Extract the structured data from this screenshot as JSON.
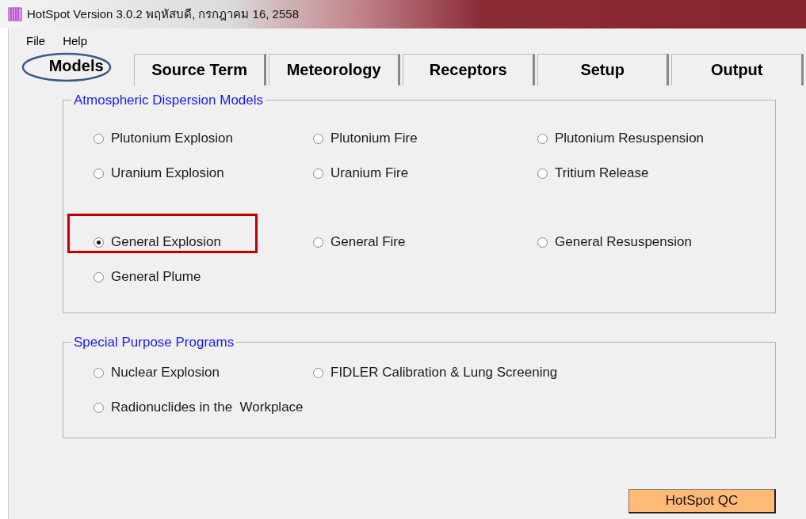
{
  "window": {
    "title": "HotSpot Version 3.0.2 พฤหัสบดี, กรกฎาคม 16, 2558"
  },
  "menu": [
    "File",
    "Help"
  ],
  "tabs": [
    {
      "label": "Models",
      "selected": true
    },
    {
      "label": "Source Term",
      "selected": false
    },
    {
      "label": "Meteorology",
      "selected": false
    },
    {
      "label": "Receptors",
      "selected": false
    },
    {
      "label": "Setup",
      "selected": false
    },
    {
      "label": "Output",
      "selected": false
    }
  ],
  "groups": [
    {
      "title": "Atmospheric Dispersion Models",
      "rows": [
        [
          {
            "label": "Plutonium Explosion",
            "selected": false
          },
          {
            "label": "Plutonium Fire",
            "selected": false
          },
          {
            "label": "Plutonium Resuspension",
            "selected": false
          }
        ],
        [
          {
            "label": "Uranium Explosion",
            "selected": false
          },
          {
            "label": "Uranium Fire",
            "selected": false
          },
          {
            "label": "Tritium Release",
            "selected": false
          }
        ],
        [
          {
            "label": "General Explosion",
            "selected": true
          },
          {
            "label": "General Fire",
            "selected": false
          },
          {
            "label": "General Resuspension",
            "selected": false
          }
        ],
        [
          {
            "label": "General Plume",
            "selected": false
          }
        ]
      ]
    },
    {
      "title": "Special Purpose Programs",
      "rows": [
        [
          {
            "label": "Nuclear Explosion",
            "selected": false
          },
          {
            "label": "FIDLER Calibration & Lung Screening",
            "selected": false
          }
        ],
        [
          {
            "label": "Radionuclides in the  Workplace",
            "selected": false
          }
        ]
      ]
    }
  ],
  "button": "HotSpot QC"
}
